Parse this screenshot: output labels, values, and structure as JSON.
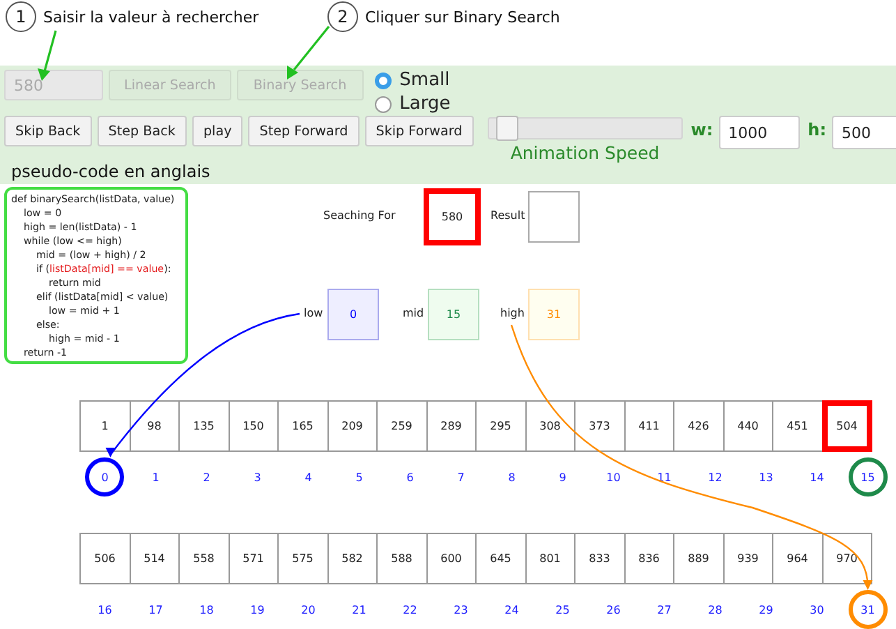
{
  "annotations": [
    {
      "number": "1",
      "text": "Saisir la valeur à rechercher"
    },
    {
      "number": "2",
      "text": "Cliquer sur Binary Search"
    }
  ],
  "toolbar": {
    "search_field": {
      "value": "580",
      "disabled": true
    },
    "search_buttons": [
      {
        "label": "Linear Search",
        "disabled": true
      },
      {
        "label": "Binary Search",
        "disabled": true
      }
    ],
    "size_options": [
      {
        "label": "Small",
        "selected": true
      },
      {
        "label": "Large",
        "selected": false
      }
    ],
    "playback_buttons": [
      "Skip Back",
      "Step Back",
      "play",
      "Step Forward",
      "Skip Forward"
    ],
    "speed_slider": {
      "level": 0.04,
      "label": "Animation Speed"
    },
    "width_field": {
      "label": "w:",
      "value": "1000"
    },
    "height_field": {
      "label": "h:",
      "value": "500"
    },
    "pseudo_code_label": "pseudo-code en anglais"
  },
  "canvas": {
    "pseudo_code": [
      {
        "text": "def binarySearch(listData, value)",
        "children": [
          {
            "text": "low = 0"
          },
          {
            "text": "high = len(listData) - 1"
          },
          {
            "text": "while (low <= high)",
            "children": [
              {
                "text": "mid = (low + high) / 2"
              },
              {
                "parts": [
                  {
                    "text": "if (",
                    "highlighted": false
                  },
                  {
                    "text": "listData[mid] == value",
                    "highlighted": true
                  },
                  {
                    "text": "):",
                    "highlighted": false
                  }
                ],
                "children": [
                  {
                    "text": "return mid"
                  }
                ]
              },
              {
                "text": "elif (listData[mid] < value)",
                "children": [
                  {
                    "text": "low = mid + 1"
                  }
                ]
              },
              {
                "text": "else:",
                "children": [
                  {
                    "text": "high = mid - 1"
                  }
                ]
              }
            ]
          },
          {
            "text": "return -1"
          }
        ]
      }
    ],
    "searching_for": {
      "label": "Seaching For",
      "value": "580"
    },
    "result": {
      "label": "Result"
    },
    "pointers": [
      {
        "kind": "low",
        "label": "low",
        "value": "0",
        "color": "#0000ff",
        "arrow": true
      },
      {
        "kind": "mid",
        "label": "mid",
        "value": "15",
        "color": "#1e8a4a",
        "arrow": false
      },
      {
        "kind": "high",
        "label": "high",
        "value": "31",
        "color": "#ff8c00",
        "arrow": true
      }
    ],
    "array_rows": [
      {
        "cells": [
          {
            "value": "1",
            "index": "0",
            "color": "#0000ff",
            "highlighted": false
          },
          {
            "value": "98",
            "index": "1",
            "highlighted": false
          },
          {
            "value": "135",
            "index": "2",
            "highlighted": false
          },
          {
            "value": "150",
            "index": "3",
            "highlighted": false
          },
          {
            "value": "165",
            "index": "4",
            "highlighted": false
          },
          {
            "value": "209",
            "index": "5",
            "highlighted": false
          },
          {
            "value": "259",
            "index": "6",
            "highlighted": false
          },
          {
            "value": "289",
            "index": "7",
            "highlighted": false
          },
          {
            "value": "295",
            "index": "8",
            "highlighted": false
          },
          {
            "value": "308",
            "index": "9",
            "highlighted": false
          },
          {
            "value": "373",
            "index": "10",
            "highlighted": false
          },
          {
            "value": "411",
            "index": "11",
            "highlighted": false
          },
          {
            "value": "426",
            "index": "12",
            "highlighted": false
          },
          {
            "value": "440",
            "index": "13",
            "highlighted": false
          },
          {
            "value": "451",
            "index": "14",
            "highlighted": false
          },
          {
            "value": "504",
            "index": "15",
            "color": "#1e8a4a",
            "highlighted": true
          }
        ]
      },
      {
        "cells": [
          {
            "value": "506",
            "index": "16",
            "highlighted": false
          },
          {
            "value": "514",
            "index": "17",
            "highlighted": false
          },
          {
            "value": "558",
            "index": "18",
            "highlighted": false
          },
          {
            "value": "571",
            "index": "19",
            "highlighted": false
          },
          {
            "value": "575",
            "index": "20",
            "highlighted": false
          },
          {
            "value": "582",
            "index": "21",
            "highlighted": false
          },
          {
            "value": "588",
            "index": "22",
            "highlighted": false
          },
          {
            "value": "600",
            "index": "23",
            "highlighted": false
          },
          {
            "value": "645",
            "index": "24",
            "highlighted": false
          },
          {
            "value": "801",
            "index": "25",
            "highlighted": false
          },
          {
            "value": "833",
            "index": "26",
            "highlighted": false
          },
          {
            "value": "836",
            "index": "27",
            "highlighted": false
          },
          {
            "value": "889",
            "index": "28",
            "highlighted": false
          },
          {
            "value": "939",
            "index": "29",
            "highlighted": false
          },
          {
            "value": "964",
            "index": "30",
            "highlighted": false
          },
          {
            "value": "970",
            "index": "31",
            "color": "#ff8c00",
            "highlighted": false
          }
        ]
      }
    ]
  }
}
